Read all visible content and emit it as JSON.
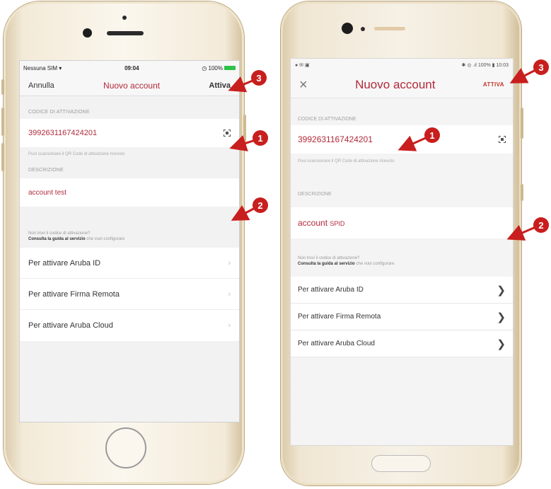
{
  "iphone": {
    "status": {
      "carrier": "Nessuna SIM",
      "time": "09:04",
      "battery": "100%"
    },
    "nav": {
      "cancel": "Annulla",
      "title": "Nuovo account",
      "activate": "Attiva"
    },
    "activation_code_label": "CODICE DI ATTIVAZIONE",
    "activation_code": "3992631167424201",
    "qr_note": "Puoi scansionare il QR Code di attivazione ricevuto",
    "description_label": "DESCRIZIONE",
    "description": "account test",
    "help_line1": "Non trovi il codice di attivazione?",
    "help_line2_bold": "Consulta la guida al servizio",
    "help_line2_rest": " che vuoi configurare",
    "items": [
      {
        "label": "Per attivare Aruba ID"
      },
      {
        "label": "Per attivare Firma Remota"
      },
      {
        "label": "Per attivare Aruba Cloud"
      }
    ]
  },
  "android": {
    "status": {
      "time": "10:03",
      "battery": "100%"
    },
    "nav": {
      "close": "×",
      "title": "Nuovo account",
      "activate": "ATTIVA"
    },
    "activation_code_label": "CODICE DI ATTIVAZIONE",
    "activation_code": "3992631167424201",
    "qr_note": "Puoi scansionare il QR Code di attivazione ricevuto",
    "description_label": "DESCRIZIONE",
    "description_word": "account",
    "description_suffix": "SPID",
    "help_line1": "Non trovi il codice di attivazione?",
    "help_line2_bold": "Consulta la guida al servizio",
    "help_line2_rest": " che vuoi configurare",
    "items": [
      {
        "label": "Per attivare Aruba ID"
      },
      {
        "label": "Per attivare Firma Remota"
      },
      {
        "label": "Per attivare Aruba Cloud"
      }
    ]
  },
  "callouts": [
    "1",
    "2",
    "3"
  ],
  "colors": {
    "brand_red": "#b22a3a",
    "callout_red": "#c81e1e"
  },
  "icons": {
    "qr": "qr-scan-icon",
    "chevron": "chevron-right-icon"
  }
}
